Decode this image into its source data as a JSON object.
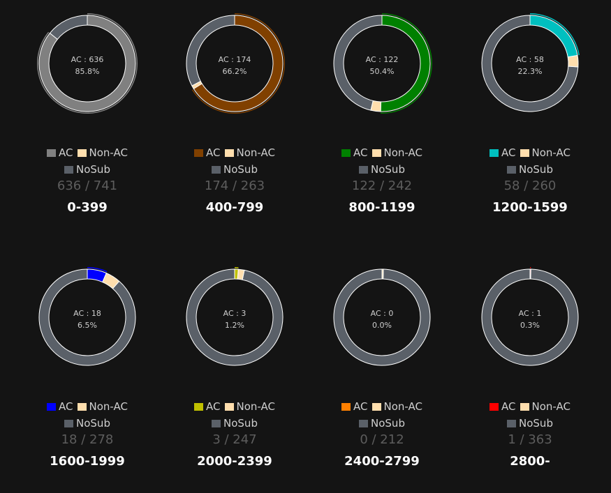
{
  "chart_data": [
    {
      "type": "pie",
      "center_label": "AC : 636",
      "center_pct": "85.8%",
      "counts": "636 / 741",
      "range_label": "0-399",
      "ac": 636,
      "total": 741,
      "nonac": 0,
      "ac_color": "#808080",
      "legend": [
        "AC",
        "Non-AC",
        "NoSub"
      ]
    },
    {
      "type": "pie",
      "center_label": "AC : 174",
      "center_pct": "66.2%",
      "counts": "174 / 263",
      "range_label": "400-799",
      "ac": 174,
      "total": 263,
      "nonac": 3,
      "ac_color": "#804000",
      "legend": [
        "AC",
        "Non-AC",
        "NoSub"
      ]
    },
    {
      "type": "pie",
      "center_label": "AC : 122",
      "center_pct": "50.4%",
      "counts": "122 / 242",
      "range_label": "800-1199",
      "ac": 122,
      "total": 242,
      "nonac": 8,
      "ac_color": "#008000",
      "legend": [
        "AC",
        "Non-AC",
        "NoSub"
      ]
    },
    {
      "type": "pie",
      "center_label": "AC : 58",
      "center_pct": "22.3%",
      "counts": "58 / 260",
      "range_label": "1200-1599",
      "ac": 58,
      "total": 260,
      "nonac": 10,
      "ac_color": "#00c0c0",
      "legend": [
        "AC",
        "Non-AC",
        "NoSub"
      ]
    },
    {
      "type": "pie",
      "center_label": "AC : 18",
      "center_pct": "6.5%",
      "counts": "18 / 278",
      "range_label": "1600-1999",
      "ac": 18,
      "total": 278,
      "nonac": 14,
      "ac_color": "#0000ff",
      "legend": [
        "AC",
        "Non-AC",
        "NoSub"
      ]
    },
    {
      "type": "pie",
      "center_label": "AC : 3",
      "center_pct": "1.2%",
      "counts": "3 / 247",
      "range_label": "2000-2399",
      "ac": 3,
      "total": 247,
      "nonac": 5,
      "ac_color": "#c0c000",
      "legend": [
        "AC",
        "Non-AC",
        "NoSub"
      ]
    },
    {
      "type": "pie",
      "center_label": "AC : 0",
      "center_pct": "0.0%",
      "counts": "0 / 212",
      "range_label": "2400-2799",
      "ac": 0,
      "total": 212,
      "nonac": 1,
      "ac_color": "#ff8000",
      "legend": [
        "AC",
        "Non-AC",
        "NoSub"
      ]
    },
    {
      "type": "pie",
      "center_label": "AC : 1",
      "center_pct": "0.3%",
      "counts": "1 / 363",
      "range_label": "2800-",
      "ac": 1,
      "total": 363,
      "nonac": 0,
      "ac_color": "#ff0000",
      "legend": [
        "AC",
        "Non-AC",
        "NoSub"
      ]
    }
  ],
  "colors": {
    "nonac": "#ffdead",
    "nosub": "#5a6068",
    "background": "#141414"
  }
}
